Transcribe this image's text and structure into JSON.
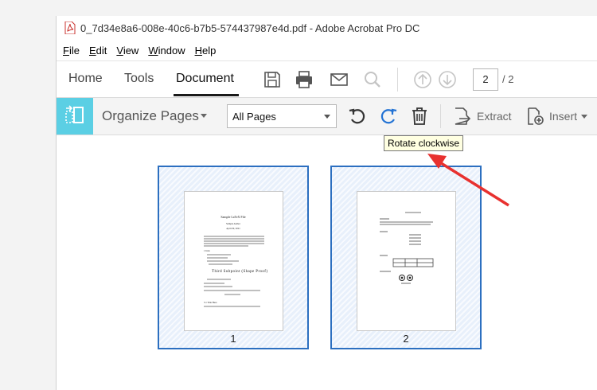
{
  "window": {
    "title": "0_7d34e8a6-008e-40c6-b7b5-574437987e4d.pdf - Adobe Acrobat Pro DC"
  },
  "menu": [
    "File",
    "Edit",
    "View",
    "Window",
    "Help"
  ],
  "nav": {
    "tabs": [
      "Home",
      "Tools",
      "Document"
    ],
    "active": "Document"
  },
  "pager": {
    "current": "2",
    "total": "/ 2"
  },
  "organize": {
    "title": "Organize Pages",
    "page_range": "All Pages",
    "extract_label": "Extract",
    "insert_label": "Insert",
    "tooltip": "Rotate clockwise"
  },
  "colors": {
    "accent": "#5bcfe4",
    "selection_border": "#2c6fc0",
    "rotate_cw": "#2373d4",
    "annotation_arrow": "#e8312f"
  },
  "pages": [
    {
      "number": "1",
      "lines": [
        "Sample LaTeX File",
        "Sample Author",
        "April 29, 2021",
        "1 Intro",
        "1.1 Subsection",
        "2 Equations",
        "2.1 Sample Equation",
        "Third Subpoint (Shape Proof)",
        "3.1 Title Here"
      ]
    },
    {
      "number": "2"
    }
  ]
}
